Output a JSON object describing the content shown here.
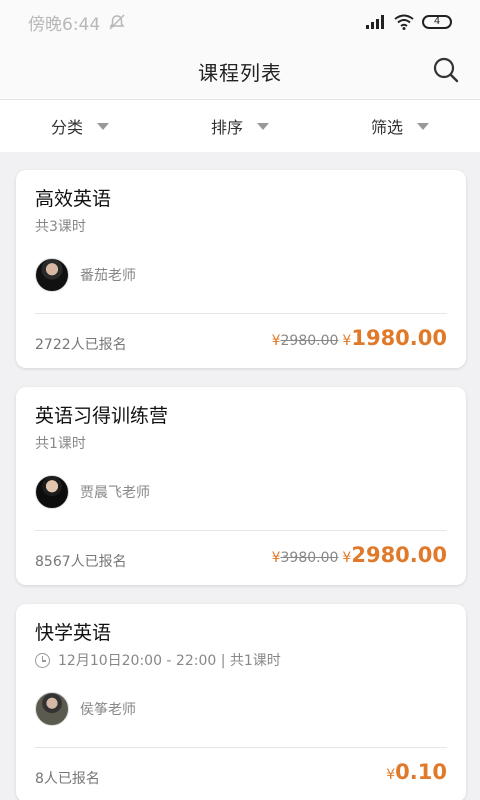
{
  "status": {
    "time": "傍晚6:44",
    "battery": "4"
  },
  "header": {
    "title": "课程列表",
    "search_icon": "search-icon"
  },
  "filters": [
    {
      "label": "分类"
    },
    {
      "label": "排序"
    },
    {
      "label": "筛选"
    }
  ],
  "courses": [
    {
      "title": "高效英语",
      "subtitle": "共3课时",
      "teacher": "番茄老师",
      "enrolled": "2722人已报名",
      "old_currency": "¥",
      "old_price": "2980.00",
      "currency": "¥",
      "price": "1980.00"
    },
    {
      "title": "英语习得训练营",
      "subtitle": "共1课时",
      "teacher": "贾晨飞老师",
      "enrolled": "8567人已报名",
      "old_currency": "¥",
      "old_price": "3980.00",
      "currency": "¥",
      "price": "2980.00"
    },
    {
      "title": "快学英语",
      "subtitle": "12月10日20:00 - 22:00 | 共1课时",
      "teacher": "侯筝老师",
      "enrolled": "8人已报名",
      "currency": "¥",
      "price": "0.10"
    }
  ],
  "colors": {
    "accent": "#e07a2a",
    "muted": "#888888",
    "background": "#f1f1f3"
  }
}
